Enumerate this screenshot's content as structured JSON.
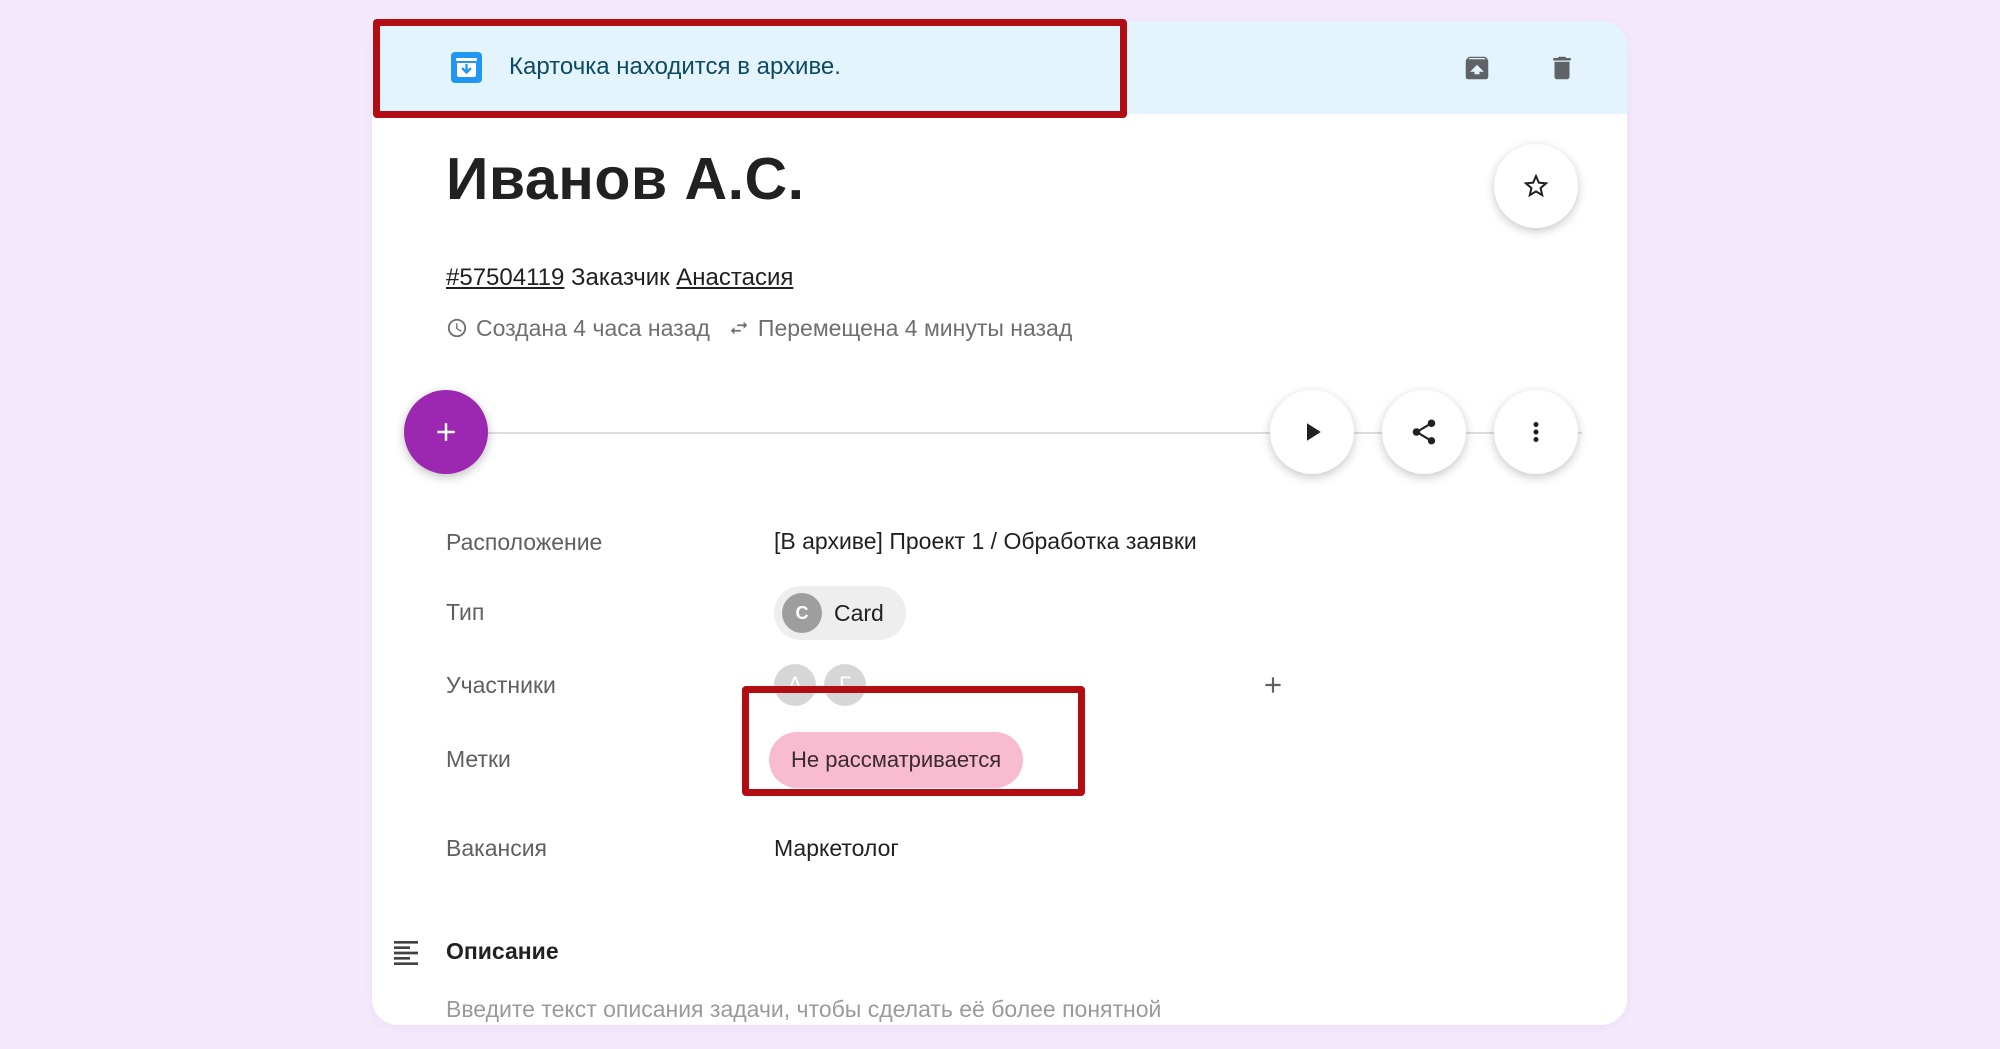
{
  "banner": {
    "text": "Карточка находится в архиве.",
    "icon": "archive-icon",
    "actions": [
      {
        "name": "unarchive-button",
        "icon": "unarchive-icon"
      },
      {
        "name": "delete-button",
        "icon": "trash-icon"
      },
      {
        "name": "fullscreen-button",
        "icon": "fullscreen-icon"
      },
      {
        "name": "close-button",
        "icon": "close-icon"
      }
    ]
  },
  "card": {
    "title": "Иванов А.С.",
    "id": "#57504119",
    "customer_label": "Заказчик",
    "customer_name": "Анастасия",
    "created": "Создана 4 часа назад",
    "moved": "Перемещена 4 минуты назад"
  },
  "fields": {
    "location": {
      "label": "Расположение",
      "value": "[В архиве] Проект 1 / Обработка заявки"
    },
    "type": {
      "label": "Тип",
      "value": "Card",
      "avatar": "C"
    },
    "members": {
      "label": "Участники",
      "avatars": [
        "А",
        "Г"
      ]
    },
    "tags": {
      "label": "Метки",
      "value": "Не рассматривается"
    },
    "vacancy": {
      "label": "Вакансия",
      "value": "Маркетолог"
    }
  },
  "description": {
    "title": "Описание",
    "placeholder": "Введите текст описания задачи, чтобы сделать её более понятной"
  },
  "colors": {
    "banner_bg": "#e3f4fc",
    "accent_purple": "#9c27b0",
    "tag_pink": "#f8bbd0",
    "highlight_red": "#b10d13",
    "page_bg": "#f3e9fb"
  }
}
